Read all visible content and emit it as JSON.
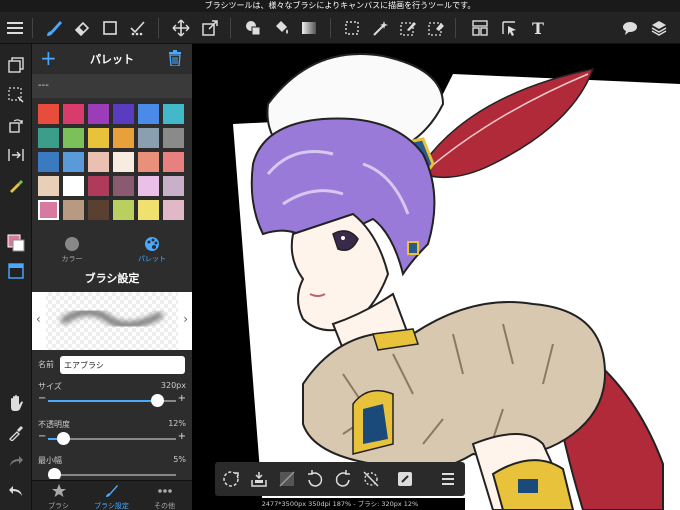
{
  "status_bar": {
    "text": "ブラシツールは、様々なブラシによりキャンバスに描画を行うツールです。"
  },
  "toolbar": {
    "menu_icon": "menu-icon",
    "tools": [
      "brush",
      "eraser",
      "rectangle",
      "select-magic",
      "move",
      "transform",
      "fill",
      "bucket",
      "gradient",
      "lasso-select",
      "magic-wand",
      "select-pen",
      "select-eraser",
      "layout",
      "select-move",
      "text"
    ],
    "right": [
      "speech-bubble",
      "layers"
    ],
    "text_tool_label": "T"
  },
  "panel": {
    "title": "パレット",
    "palette_name": "---",
    "swatch_colors": [
      "#e84c3d",
      "#d93c6c",
      "#9b3cb8",
      "#5a3cc0",
      "#4a8ae8",
      "#43b8c8",
      "#3a9e8a",
      "#7cc05a",
      "#e8c23a",
      "#e8a03a",
      "#8aa0b0",
      "#8a8a8a",
      "#3a7ac0",
      "#5a9ad8",
      "#eac0b0",
      "#f8ece0",
      "#e8907a",
      "#e88080",
      "#e8d0b8",
      "#ffffff",
      "#b03a5a",
      "#8a5a70",
      "#eac0e8",
      "#c8b0c8",
      "#d87aa0",
      "#b89a80",
      "#5a4030",
      "#b8d060",
      "#f0e070",
      "#e0b8c8"
    ],
    "tabs": [
      {
        "label": "カラー"
      },
      {
        "label": "パレット"
      }
    ],
    "brush_settings_title": "ブラシ設定",
    "name_label": "名前",
    "name_value": "エアブラシ",
    "sliders": [
      {
        "label": "サイズ",
        "value_text": "320px",
        "level": 0.85
      },
      {
        "label": "不透明度",
        "value_text": "12%",
        "level": 0.12
      },
      {
        "label": "最小幅",
        "value_text": "5%",
        "level": 0.05
      }
    ],
    "bottom_tabs": [
      {
        "label": "ブラシ"
      },
      {
        "label": "ブラシ設定"
      },
      {
        "label": "その他"
      }
    ]
  },
  "bottom_bar": {
    "tools": [
      "select-rotate",
      "import-tray",
      "flip-off",
      "undo",
      "redo",
      "no-selection",
      "edit",
      "menu"
    ]
  },
  "info_text": "2477*3500px 350dpi 187% - ブラシ: 320px 12%",
  "colors": {
    "accent": "#4aa9ff",
    "toolbar_bg": "#232323",
    "panel_bg": "#2d2d2d"
  }
}
